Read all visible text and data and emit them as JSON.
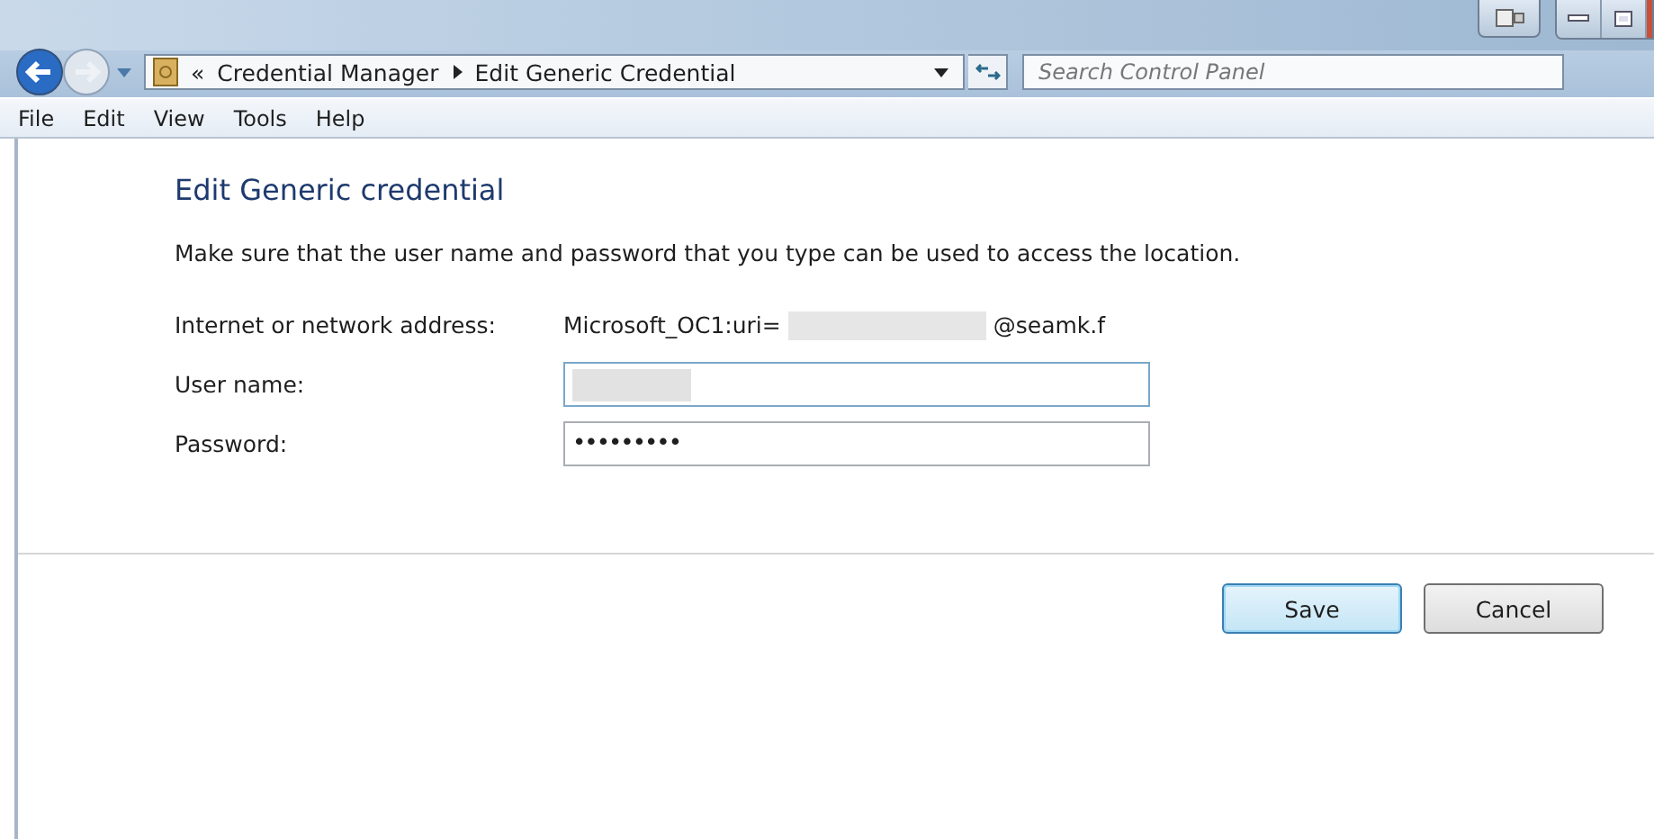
{
  "navigation": {
    "back_enabled": true,
    "forward_enabled": false
  },
  "breadcrumb": {
    "overflow": "«",
    "items": [
      "Credential Manager",
      "Edit Generic Credential"
    ]
  },
  "search": {
    "placeholder": "Search Control Panel"
  },
  "menu": [
    "File",
    "Edit",
    "View",
    "Tools",
    "Help"
  ],
  "form": {
    "heading": "Edit Generic credential",
    "description": "Make sure that the user name and password that you type can be used to access the location.",
    "address_label": "Internet or network address:",
    "address_prefix": "Microsoft_OC1:uri=",
    "address_suffix": "@seamk.f",
    "username_label": "User name:",
    "password_label": "Password:",
    "password_value": "•••••••••"
  },
  "buttons": [
    {
      "label": "Save",
      "default": true
    },
    {
      "label": "Cancel",
      "default": false
    }
  ]
}
